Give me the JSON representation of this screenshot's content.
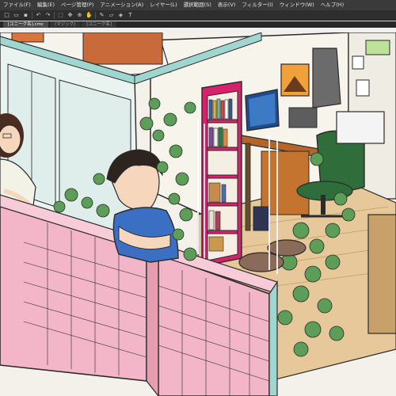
{
  "menubar": {
    "items": [
      "ファイル(F)",
      "編集(E)",
      "ページ管理(P)",
      "アニメーション(A)",
      "レイヤー(L)",
      "選択範囲(S)",
      "表示(V)",
      "フィルター(I)",
      "ウィンドウ(W)",
      "ヘルプ(H)"
    ]
  },
  "tabs": [
    "[ユニーク名].cmc",
    "(マジック)",
    "[ユニーク名]"
  ],
  "colors": {
    "wall_pink": "#f3b6c8",
    "wall_teal": "#9fd6cf",
    "floor_wood": "#e7c89a",
    "shelf_magenta": "#d6226d",
    "chair_green": "#2f6e3b",
    "ivy_green": "#5c9e58"
  },
  "icons": [
    "new-file-icon",
    "open-icon",
    "save-icon",
    "undo-icon",
    "redo-icon",
    "select-icon",
    "move-icon",
    "zoom-icon",
    "hand-icon",
    "pen-icon",
    "eraser-icon",
    "fill-icon",
    "text-icon"
  ]
}
